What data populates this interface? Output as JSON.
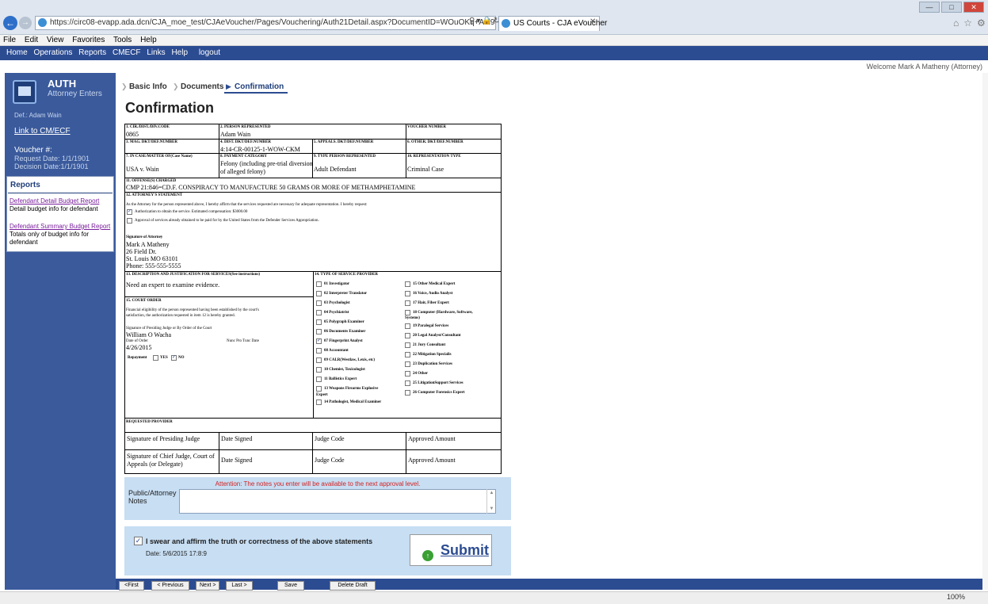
{
  "browser": {
    "url": "https://circ08-evapp.ada.dcn/CJA_moe_test/CJAeVoucher/Pages/Vouchering/Auth21Detail.aspx?DocumentID=WOuOKq+Ael94h7LPb1T+yQ=",
    "tab_title": "US Courts - CJA eVoucher",
    "zoom": "100%"
  },
  "menu": [
    "File",
    "Edit",
    "View",
    "Favorites",
    "Tools",
    "Help"
  ],
  "app_nav": [
    "Home",
    "Operations",
    "Reports",
    "CMECF",
    "Links",
    "Help",
    "logout"
  ],
  "welcome": "Welcome Mark A Matheny (Attorney)",
  "sidebar": {
    "title": "AUTH",
    "subtitle": "Attorney Enters",
    "defendant": "Def.: Adam Wain",
    "cmecf_link": "Link to CM/ECF",
    "voucher_label": "Voucher #:",
    "request_date": "Request Date: 1/1/1901",
    "decision_date": "Decision Date:1/1/1901",
    "reports_heading": "Reports",
    "report1_link": "Defendant Detail Budget Report",
    "report1_desc": "Detail budget info for defendant",
    "report2_link": "Defendant Summary Budget Report",
    "report2_desc": "Totals only of budget info for defendant"
  },
  "breadcrumb": [
    "Basic Info",
    "Documents",
    "Confirmation"
  ],
  "page_title": "Confirmation",
  "form": {
    "f1_label": "1. CIR./DIST./DIV.CODE",
    "f1_value": "0865",
    "f2_label": "2. PERSON REPRESENTED",
    "f2_value": "Adam Wain",
    "f_voucher_label": "VOUCHER NUMBER",
    "f3_label": "3. MAG. DKT/DEF.NUMBER",
    "f4_label": "4. DIST. DKT/DEF.NUMBER",
    "f4_value": "4:14-CR-00125-1-WOW-CKM",
    "f5_label": "5. APPEALS. DKT/DEF.NUMBER",
    "f6_label": "6. OTHER. DKT/DEF.NUMBER",
    "f7_label": "7. IN CASE/MATTER OF(Case Name)",
    "f7_value": "USA v. Wain",
    "f8_label": "8. PAYMENT CATEGORY",
    "f8_value_1": "Felony (including pre-trial diversion",
    "f8_value_2": "of alleged felony)",
    "f9_label": "9. TYPE PERSON REPRESENTED",
    "f9_value": "Adult Defendant",
    "f10_label": "10. REPRESENTATION TYPE",
    "f10_value": "Criminal Case",
    "f11_label": "11. OFFENSE(S) CHARGED",
    "f11_value": "CMP 21:846=CD.F. CONSPIRACY TO MANUFACTURE 50 GRAMS OR MORE OF METHAMPHETAMINE",
    "f12_label": "12. ATTORNEY'S STATEMENT",
    "f12_text": "As the Attorney for the person represented above, I hereby affirm that the services requested are necessary for adequate representation. I hereby request:",
    "f12_opt1": "Authorization to obtain the service. Estimated compensation: $3000.00",
    "f12_opt2": "Approval of services already obtained to be paid for by the United States from the Defender Services Appropriation.",
    "sig_attorney_label": "Signature of Attorney",
    "attorney_name": "Mark A Matheny",
    "attorney_addr1": "26 Field Dr.",
    "attorney_addr2": "St. Louis MO 63101",
    "attorney_phone": "Phone: 555-555-5555",
    "f13_label": "13. DESCRIPTION AND JUSTIFICATION FOR SERVICES(See instructions)",
    "f13_value": "Need an expert to examine evidence.",
    "f15_label": "15. COURT ORDER",
    "f15_text_1": "Financial eligibility of the person represented having been established by the court's",
    "f15_text_2": "satisfaction, the authorization requested in item 12 is hereby granted.",
    "f15_sig_label": "Signature of Presiding Judge or By Order of the Court",
    "judge_name": "William O Wacha",
    "date_order_label": "Date of Order",
    "nunc_label": "Nunc Pro Tunc Date",
    "date_order": "4/26/2015",
    "repayment_label": "Repayment",
    "yes_label": "YES",
    "no_label": "NO",
    "f14_label": "14. TYPE OF SERVICE PROVIDER",
    "services_left": [
      "01 Investigator",
      "02 Interpreter Translator",
      "03 Psychologist",
      "04 Psychiatrist",
      "05 Polygraph Examiner",
      "06 Documents Examiner",
      "07 Fingerprint Analyst",
      "08 Accountant",
      "09 CALR(Westlaw, Lexis, etc)",
      "10 Chemist, Toxicologist",
      "11 Ballistics Expert",
      "13 Weapons Firearms Explosive",
      "14 Pathologist, Medical Examiner"
    ],
    "service_13_cont": "Expert",
    "services_right": [
      "15 Other Medical Expert",
      "16 Voice, Audio Analyst",
      "17 Hair, Fiber Expert",
      "18 Computer (Hardware, Software,",
      "19 Paralegal Services",
      "20 Legal Analyst/Consultant",
      "21 Jury Consultant",
      "22 Mitigation Specialis",
      "23 Duplication Services",
      "24 Other",
      "25 LitigationSupport Services",
      "26 Computer Forensics Expert"
    ],
    "service_18_cont": "Systems)",
    "requested_provider": "REQUESTED PROVIDER",
    "sig_presiding": "Signature of Presiding Judge",
    "date_signed": "Date Signed",
    "judge_code": "Judge Code",
    "approved_amount": "Approved Amount",
    "sig_chief_1": "Signature of Chief Judge, Court of",
    "sig_chief_2": "Appeals (or Delegate)"
  },
  "notes": {
    "attention": "Attention: The notes you enter will be available to the next approval level.",
    "label": "Public/Attorney Notes",
    "value": ""
  },
  "affirm": {
    "text": "I swear and affirm the truth or correctness of the above statements",
    "date": "Date: 5/6/2015 17:8:9",
    "submit": "Submit"
  },
  "bottom_buttons": [
    "<First",
    "< Previous",
    "Next >",
    "Last >",
    "Save",
    "Delete Draft"
  ],
  "colors": {
    "nav_blue": "#2c4c92",
    "sidebar_blue": "#3a5a9c",
    "panel_light_blue": "#c7def3",
    "attention_red": "#d42020"
  }
}
